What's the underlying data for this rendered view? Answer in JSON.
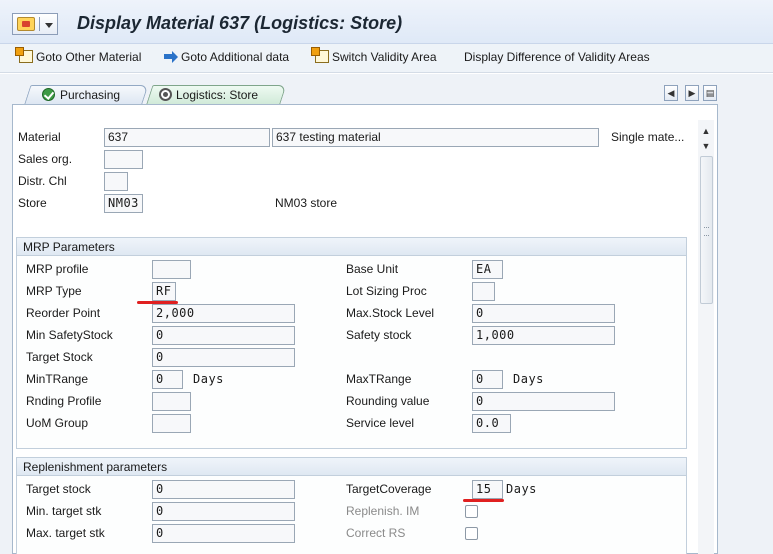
{
  "window": {
    "title": "Display Material 637 (Logistics: Store)"
  },
  "toolbar": {
    "goto_other_material": "Goto Other Material",
    "goto_additional_data": "Goto Additional data",
    "switch_validity_area": "Switch Validity Area",
    "display_difference": "Display Difference of Validity Areas"
  },
  "tabs": [
    {
      "label": "Purchasing",
      "icon": "check-icon"
    },
    {
      "label": "Logistics: Store",
      "icon": "target-icon",
      "active": true
    }
  ],
  "header": {
    "material_label": "Material",
    "material_value": "637",
    "material_desc": "637 testing material",
    "material_type": "Single mate...",
    "sales_org_label": "Sales org.",
    "sales_org_value": "",
    "distr_chl_label": "Distr. Chl",
    "distr_chl_value": "",
    "store_label": "Store",
    "store_value": "NM03",
    "store_desc": "NM03 store"
  },
  "mrp": {
    "title": "MRP Parameters",
    "mrp_profile_label": "MRP profile",
    "mrp_profile_value": "",
    "mrp_type_label": "MRP Type",
    "mrp_type_value": "RF",
    "reorder_point_label": "Reorder Point",
    "reorder_point_value": "2,000",
    "min_safety_stock_label": "Min SafetyStock",
    "min_safety_stock_value": "0",
    "target_stock_label": "Target Stock",
    "target_stock_value": "0",
    "min_tr_range_label": "MinTRange",
    "min_tr_range_value": "0",
    "min_tr_range_unit": "Days",
    "rnding_profile_label": "Rnding Profile",
    "rnding_profile_value": "",
    "uom_group_label": "UoM Group",
    "uom_group_value": "",
    "base_unit_label": "Base Unit",
    "base_unit_value": "EA",
    "lot_sizing_label": "Lot Sizing Proc",
    "lot_sizing_value": "",
    "max_stock_level_label": "Max.Stock Level",
    "max_stock_level_value": "0",
    "safety_stock_label": "Safety stock",
    "safety_stock_value": "1,000",
    "max_tr_range_label": "MaxTRange",
    "max_tr_range_value": "0",
    "max_tr_range_unit": "Days",
    "rounding_value_label": "Rounding value",
    "rounding_value_value": "0",
    "service_level_label": "Service level",
    "service_level_value": "0.0"
  },
  "replenishment": {
    "title": "Replenishment parameters",
    "target_stock_label": "Target stock",
    "target_stock_value": "0",
    "min_target_stk_label": "Min. target stk",
    "min_target_stk_value": "0",
    "max_target_stk_label": "Max. target stk",
    "max_target_stk_value": "0",
    "target_coverage_label": "TargetCoverage",
    "target_coverage_value": "15",
    "target_coverage_unit": "Days",
    "replenish_im_label": "Replenish. IM",
    "replenish_im_checked": false,
    "correct_rs_label": "Correct RS",
    "correct_rs_checked": false
  },
  "annotations": {
    "highlight_color": "#e02020"
  }
}
